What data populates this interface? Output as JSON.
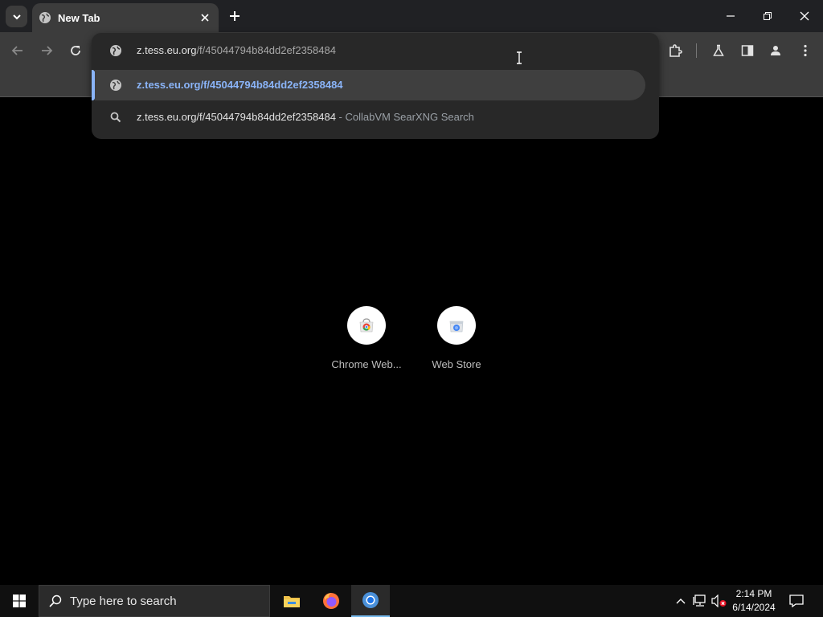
{
  "browser": {
    "tab": {
      "title": "New Tab"
    },
    "omnibox": {
      "input_host": "z.tess.eu.org",
      "input_path": "/f/45044794b84dd2ef2358484",
      "suggestions": [
        {
          "type": "url",
          "icon": "globe-icon",
          "text": "z.tess.eu.org/f/45044794b84dd2ef2358484",
          "suffix": ""
        },
        {
          "type": "search",
          "icon": "search-icon",
          "text": "z.tess.eu.org/f/45044794b84dd2ef2358484",
          "suffix": " - CollabVM SearXNG Search"
        }
      ]
    },
    "shortcuts": [
      {
        "label": "Chrome Web..."
      },
      {
        "label": "Web Store"
      }
    ]
  },
  "taskbar": {
    "search_placeholder": "Type here to search",
    "time": "2:14 PM",
    "date": "6/14/2024"
  },
  "colors": {
    "accent": "#8ab4f8",
    "toolbar": "#3c3c3c",
    "tabstrip": "#202124",
    "taskbar": "#101010"
  }
}
